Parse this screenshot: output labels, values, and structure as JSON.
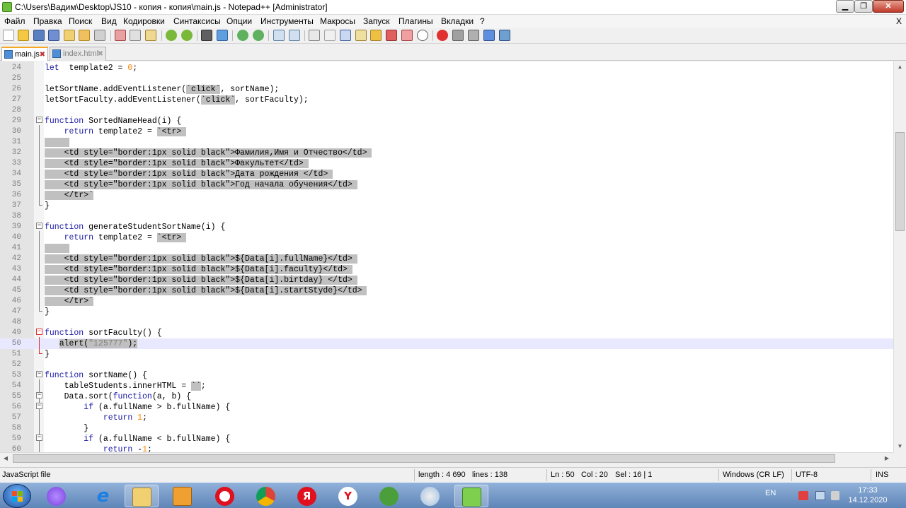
{
  "window": {
    "title": "C:\\Users\\Вадим\\Desktop\\JS10 - копия - копия\\main.js - Notepad++ [Administrator]",
    "buttons": {
      "minimize": "▁",
      "maximize": "❐",
      "close": "✕"
    }
  },
  "menu": {
    "items": [
      "Файл",
      "Правка",
      "Поиск",
      "Вид",
      "Кодировки",
      "Синтаксисы",
      "Опции",
      "Инструменты",
      "Макросы",
      "Запуск",
      "Плагины",
      "Вкладки",
      "?"
    ],
    "close": "X"
  },
  "tabs": [
    {
      "label": "main.js",
      "active": true
    },
    {
      "label": "index.html",
      "active": false
    }
  ],
  "editor": {
    "current_line": 50,
    "lines": [
      {
        "n": "24",
        "segs": [
          [
            "kw",
            "let"
          ],
          [
            "",
            "  template2 = "
          ],
          [
            "num",
            "0"
          ],
          [
            "",
            ";"
          ]
        ]
      },
      {
        "n": "25",
        "segs": []
      },
      {
        "n": "26",
        "segs": [
          [
            "",
            "letSortName.addEventListener("
          ],
          [
            "sel",
            "`click`"
          ],
          [
            "",
            ", sortName);"
          ]
        ]
      },
      {
        "n": "27",
        "segs": [
          [
            "",
            "letSortFaculty.addEventListener("
          ],
          [
            "sel",
            "`click`"
          ],
          [
            "",
            ", sortFaculty);"
          ]
        ]
      },
      {
        "n": "28",
        "segs": []
      },
      {
        "n": "29",
        "segs": [
          [
            "kw",
            "function"
          ],
          [
            "",
            " SortedNameHead(i) {"
          ]
        ]
      },
      {
        "n": "30",
        "segs": [
          [
            "",
            "    "
          ],
          [
            "kw",
            "return"
          ],
          [
            "",
            " template2 = "
          ],
          [
            "sel",
            "`<tr> "
          ]
        ]
      },
      {
        "n": "31",
        "segs": [
          [
            "sel",
            "     "
          ]
        ]
      },
      {
        "n": "32",
        "segs": [
          [
            "sel",
            "    <td style=\"border:1px solid black\">Фамилия,Имя и Отчество</td> "
          ]
        ]
      },
      {
        "n": "33",
        "segs": [
          [
            "sel",
            "    <td style=\"border:1px solid black\">Факультет</td> "
          ]
        ]
      },
      {
        "n": "34",
        "segs": [
          [
            "sel",
            "    <td style=\"border:1px solid black\">Дата рождения </td> "
          ]
        ]
      },
      {
        "n": "35",
        "segs": [
          [
            "sel",
            "    <td style=\"border:1px solid black\">Год начала обучения</td> "
          ]
        ]
      },
      {
        "n": "36",
        "segs": [
          [
            "sel",
            "    </tr>`"
          ]
        ]
      },
      {
        "n": "37",
        "segs": [
          [
            "",
            "}"
          ]
        ]
      },
      {
        "n": "38",
        "segs": []
      },
      {
        "n": "39",
        "segs": [
          [
            "kw",
            "function"
          ],
          [
            "",
            " generateStudentSortName(i) {"
          ]
        ]
      },
      {
        "n": "40",
        "segs": [
          [
            "",
            "    "
          ],
          [
            "kw",
            "return"
          ],
          [
            "",
            " template2 = "
          ],
          [
            "sel",
            "`<tr> "
          ]
        ]
      },
      {
        "n": "41",
        "segs": [
          [
            "sel",
            "     "
          ]
        ]
      },
      {
        "n": "42",
        "segs": [
          [
            "sel",
            "    <td style=\"border:1px solid black\">${Data[i].fullName}</td> "
          ]
        ]
      },
      {
        "n": "43",
        "segs": [
          [
            "sel",
            "    <td style=\"border:1px solid black\">${Data[i].faculty}</td> "
          ]
        ]
      },
      {
        "n": "44",
        "segs": [
          [
            "sel",
            "    <td style=\"border:1px solid black\">${Data[i].birtday} </td> "
          ]
        ]
      },
      {
        "n": "45",
        "segs": [
          [
            "sel",
            "    <td style=\"border:1px solid black\">${Data[i].startStyde}</td> "
          ]
        ]
      },
      {
        "n": "46",
        "segs": [
          [
            "sel",
            "    </tr>`"
          ]
        ]
      },
      {
        "n": "47",
        "segs": [
          [
            "",
            "}"
          ]
        ]
      },
      {
        "n": "48",
        "segs": []
      },
      {
        "n": "49",
        "segs": [
          [
            "kw",
            "function"
          ],
          [
            "",
            " sortFaculty() {"
          ]
        ]
      },
      {
        "n": "50",
        "segs": [
          [
            "",
            "   "
          ],
          [
            "sel",
            "alert("
          ],
          [
            "selstr",
            "\"125777\""
          ],
          [
            "sel",
            ");"
          ]
        ]
      },
      {
        "n": "51",
        "segs": [
          [
            "",
            "}"
          ]
        ]
      },
      {
        "n": "52",
        "segs": []
      },
      {
        "n": "53",
        "segs": [
          [
            "kw",
            "function"
          ],
          [
            "",
            " sortName() {"
          ]
        ]
      },
      {
        "n": "54",
        "segs": [
          [
            "",
            "    tableStudents.innerHTML = "
          ],
          [
            "sel",
            "``"
          ],
          [
            "",
            ";"
          ]
        ]
      },
      {
        "n": "55",
        "segs": [
          [
            "",
            "    Data.sort("
          ],
          [
            "kw",
            "function"
          ],
          [
            "",
            "(a, b) {"
          ]
        ]
      },
      {
        "n": "56",
        "segs": [
          [
            "",
            "        "
          ],
          [
            "kw",
            "if"
          ],
          [
            "",
            " (a.fullName > b.fullName) {"
          ]
        ]
      },
      {
        "n": "57",
        "segs": [
          [
            "",
            "            "
          ],
          [
            "kw",
            "return"
          ],
          [
            "",
            " "
          ],
          [
            "num",
            "1"
          ],
          [
            "",
            ";"
          ]
        ]
      },
      {
        "n": "58",
        "segs": [
          [
            "",
            "        }"
          ]
        ]
      },
      {
        "n": "59",
        "segs": [
          [
            "",
            "        "
          ],
          [
            "kw",
            "if"
          ],
          [
            "",
            " (a.fullName < b.fullName) {"
          ]
        ]
      },
      {
        "n": "60",
        "segs": [
          [
            "",
            "            "
          ],
          [
            "kw",
            "return"
          ],
          [
            "",
            " -"
          ],
          [
            "num",
            "1"
          ],
          [
            "",
            ";"
          ]
        ]
      }
    ]
  },
  "status": {
    "file_type": "JavaScript file",
    "length": "length : 4 690",
    "lines": "lines : 138",
    "ln": "Ln : 50",
    "col": "Col : 20",
    "sel": "Sel : 16 | 1",
    "eol": "Windows (CR LF)",
    "encoding": "UTF-8",
    "mode": "INS"
  },
  "taskbar": {
    "yandex_letter": "Я",
    "yandex_y": "Y",
    "language": "EN",
    "time": "17:33",
    "date": "14.12.2020"
  },
  "colors": {
    "keyword": "#1a1aa6",
    "selection": "#c0c0c0",
    "current_line": "#e8e8ff",
    "number": "#ff8000"
  }
}
